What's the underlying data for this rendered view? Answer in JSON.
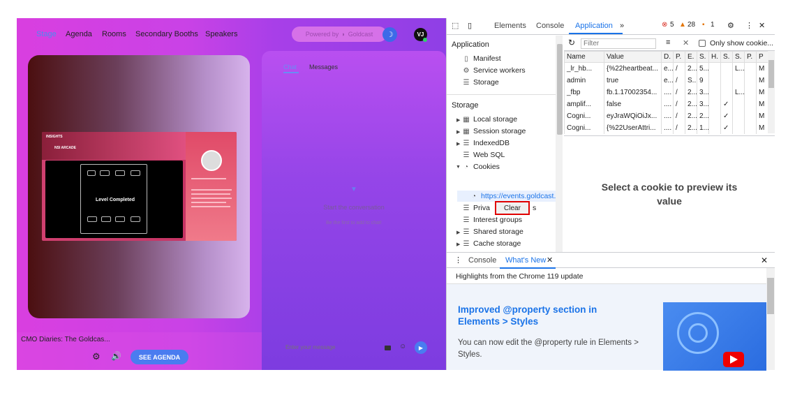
{
  "event": {
    "nav": [
      "Stage",
      "Agenda",
      "Rooms",
      "Secondary Booths",
      "Speakers"
    ],
    "powered_by": "Powered by",
    "brand": "Goldcast",
    "avatar_initials": "VJ",
    "slide_logo": "INSIGHTS",
    "slide_title": "NSI ARCADE",
    "level_text": "Level Completed",
    "session_title": "CMO Diaries: The Goldcas...",
    "see_agenda": "SEE AGENDA",
    "chat_tab": "Chat",
    "messages_tab": "Messages",
    "start_conversation": "Start the conversation",
    "be_first": "Be the first to add to chat!",
    "message_placeholder": "Enter your message"
  },
  "devtools": {
    "tabs": [
      "Elements",
      "Console",
      "Application"
    ],
    "more_tabs": "»",
    "errors": "5",
    "warnings": "28",
    "issues": "1",
    "sidebar": {
      "application_heading": "Application",
      "application_items": [
        "Manifest",
        "Service workers",
        "Storage"
      ],
      "storage_heading": "Storage",
      "storage_items": [
        "Local storage",
        "Session storage",
        "IndexedDB",
        "Web SQL",
        "Cookies"
      ],
      "cookie_origin": "https://events.goldcast.",
      "after_cookie_items": [
        "Private state tokens",
        "Interest groups",
        "Shared storage",
        "Cache storage"
      ],
      "private_prefix": "Priva",
      "private_suffix": "s"
    },
    "context_menu": {
      "clear": "Clear"
    },
    "filter_placeholder": "Filter",
    "only_show": "Only show cookie...",
    "table": {
      "headers": [
        "Name",
        "Value",
        "D.",
        "P.",
        "E.",
        "S.",
        "H.",
        "S.",
        "S.",
        "P.",
        "P"
      ],
      "rows": [
        [
          "_lr_hb...",
          "{%22heartbeat...",
          "e...",
          "/",
          "2...",
          "5...",
          "",
          "",
          "L...",
          "",
          "M"
        ],
        [
          "admin",
          "true",
          "e...",
          "/",
          "S...",
          "9",
          "",
          "",
          "",
          "",
          "M"
        ],
        [
          "_fbp",
          "fb.1.17002354...",
          "....",
          "/",
          "2...",
          "3...",
          "",
          "",
          "L...",
          "",
          "M"
        ],
        [
          "amplif...",
          "false",
          "....",
          "/",
          "2...",
          "3...",
          "",
          "✓",
          "",
          "",
          "M"
        ],
        [
          "Cogni...",
          "eyJraWQiOiJx...",
          "....",
          "/",
          "2...",
          "2...",
          "",
          "✓",
          "",
          "",
          "M"
        ],
        [
          "Cogni...",
          "{%22UserAttri...",
          "....",
          "/",
          "2...",
          "1...",
          "",
          "✓",
          "",
          "",
          "M"
        ]
      ]
    },
    "preview_text": "Select a cookie to preview its value",
    "drawer": {
      "tabs": [
        "Console",
        "What's New"
      ],
      "highlights": "Highlights from the Chrome 119 update",
      "title": "Improved @property section in Elements > Styles",
      "desc": "You can now edit the @property rule in Elements > Styles."
    }
  }
}
